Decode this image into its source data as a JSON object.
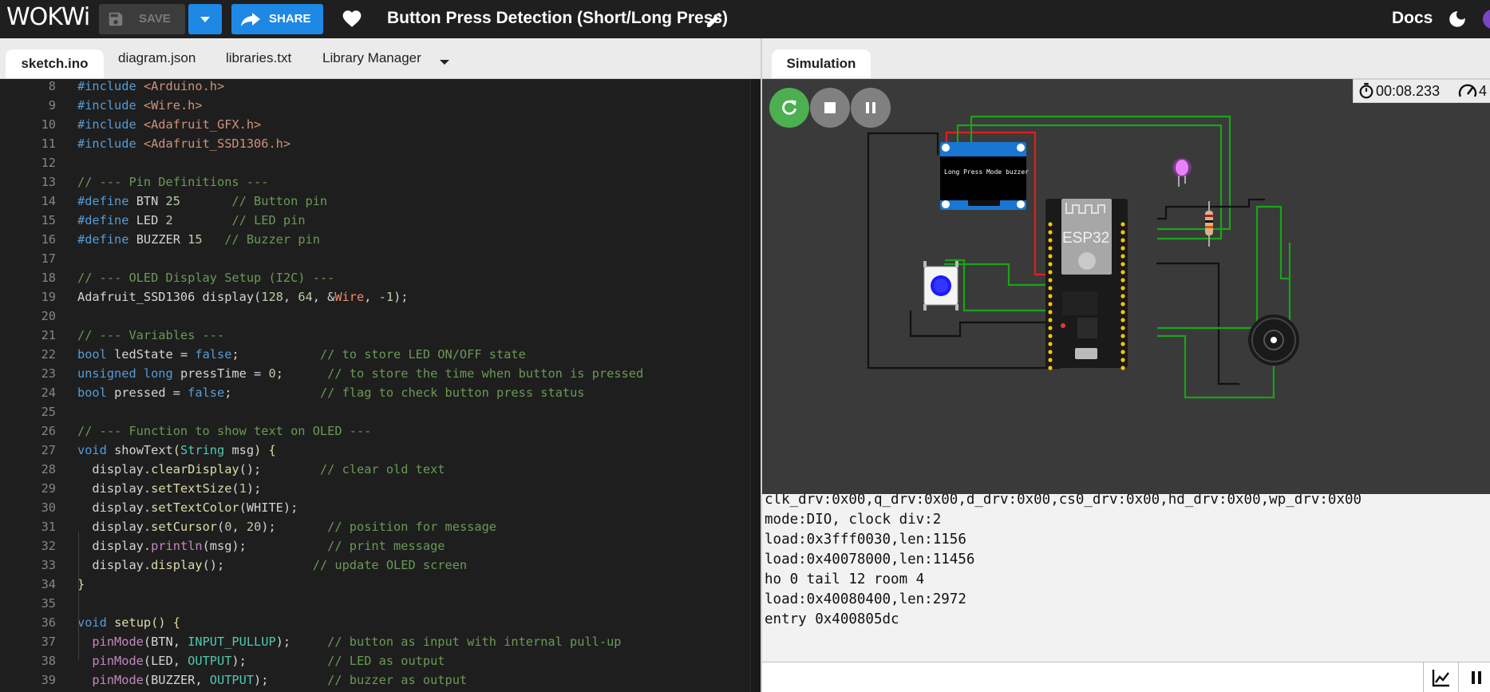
{
  "header": {
    "logo": "WOKWi",
    "save_label": "SAVE",
    "share_label": "SHARE",
    "project_title": "Button Press Detection (Short/Long Press)",
    "docs_label": "Docs"
  },
  "editor_tabs": [
    "sketch.ino",
    "diagram.json",
    "libraries.txt",
    "Library Manager"
  ],
  "simulation_tab": "Simulation",
  "timer": "00:08.233",
  "timer_trailing": "4",
  "oled_text": "Long Press Mode buzzer",
  "esp32_label": "ESP32",
  "code_lines": [
    {
      "n": "8",
      "t": [
        [
          "#include ",
          "t-p"
        ],
        [
          "<Arduino.h>",
          "t-h"
        ]
      ]
    },
    {
      "n": "9",
      "t": [
        [
          "#include ",
          "t-p"
        ],
        [
          "<Wire.h>",
          "t-h"
        ]
      ]
    },
    {
      "n": "10",
      "t": [
        [
          "#include ",
          "t-p"
        ],
        [
          "<Adafruit_GFX.h>",
          "t-h"
        ]
      ]
    },
    {
      "n": "11",
      "t": [
        [
          "#include ",
          "t-p"
        ],
        [
          "<Adafruit_SSD1306.h>",
          "t-h"
        ]
      ]
    },
    {
      "n": "12",
      "t": []
    },
    {
      "n": "13",
      "t": [
        [
          "// --- Pin Definitions ---",
          "t-c"
        ]
      ]
    },
    {
      "n": "14",
      "t": [
        [
          "#define ",
          "t-p"
        ],
        [
          "BTN ",
          ""
        ],
        [
          "25",
          "t-n"
        ],
        [
          "       ",
          ""
        ],
        [
          "// Button pin",
          "t-c"
        ]
      ]
    },
    {
      "n": "15",
      "t": [
        [
          "#define ",
          "t-p"
        ],
        [
          "LED ",
          ""
        ],
        [
          "2",
          "t-n"
        ],
        [
          "        ",
          ""
        ],
        [
          "// LED pin",
          "t-c"
        ]
      ]
    },
    {
      "n": "16",
      "t": [
        [
          "#define ",
          "t-p"
        ],
        [
          "BUZZER ",
          ""
        ],
        [
          "15",
          "t-n"
        ],
        [
          "   ",
          ""
        ],
        [
          "// Buzzer pin",
          "t-c"
        ]
      ]
    },
    {
      "n": "17",
      "t": []
    },
    {
      "n": "18",
      "t": [
        [
          "// --- OLED Display Setup (I2C) ---",
          "t-c"
        ]
      ]
    },
    {
      "n": "19",
      "t": [
        [
          "Adafruit_SSD1306 display(",
          ""
        ],
        [
          "128",
          "t-n"
        ],
        [
          ", ",
          ""
        ],
        [
          "64",
          "t-n"
        ],
        [
          ", &",
          ""
        ],
        [
          "Wire",
          "t-s"
        ],
        [
          ", ",
          ""
        ],
        [
          "-1",
          "t-n"
        ],
        [
          ");",
          ""
        ]
      ]
    },
    {
      "n": "20",
      "t": []
    },
    {
      "n": "21",
      "t": [
        [
          "// --- Variables ---",
          "t-c"
        ]
      ]
    },
    {
      "n": "22",
      "t": [
        [
          "bool ",
          "t-p"
        ],
        [
          "ledState = ",
          ""
        ],
        [
          "false",
          "t-p"
        ],
        [
          ";           ",
          ""
        ],
        [
          "// to store LED ON/OFF state",
          "t-c"
        ]
      ]
    },
    {
      "n": "23",
      "t": [
        [
          "unsigned ",
          "t-p"
        ],
        [
          "long ",
          "t-p"
        ],
        [
          "pressTime = ",
          ""
        ],
        [
          "0",
          "t-n"
        ],
        [
          ";      ",
          ""
        ],
        [
          "// to store the time when button is pressed",
          "t-c"
        ]
      ]
    },
    {
      "n": "24",
      "t": [
        [
          "bool ",
          "t-p"
        ],
        [
          "pressed = ",
          ""
        ],
        [
          "false",
          "t-p"
        ],
        [
          ";            ",
          ""
        ],
        [
          "// flag to check button press status",
          "t-c"
        ]
      ]
    },
    {
      "n": "25",
      "t": []
    },
    {
      "n": "26",
      "t": [
        [
          "// --- Function to show text on OLED ---",
          "t-c"
        ]
      ]
    },
    {
      "n": "27",
      "t": [
        [
          "void ",
          "t-p"
        ],
        [
          "showText",
          ""
        ],
        [
          "(",
          "t-f"
        ],
        [
          "String ",
          "t-ty"
        ],
        [
          "msg",
          ""
        ],
        [
          ") {",
          "t-f"
        ]
      ]
    },
    {
      "n": "28",
      "t": [
        [
          "  display.",
          ""
        ],
        [
          "clearDisplay",
          "t-f"
        ],
        [
          "();        ",
          ""
        ],
        [
          "// clear old text",
          "t-c"
        ]
      ]
    },
    {
      "n": "29",
      "t": [
        [
          "  display.",
          ""
        ],
        [
          "setTextSize",
          "t-f"
        ],
        [
          "(",
          ""
        ],
        [
          "1",
          "t-n"
        ],
        [
          ");",
          ""
        ]
      ]
    },
    {
      "n": "30",
      "t": [
        [
          "  display.",
          ""
        ],
        [
          "setTextColor",
          "t-f"
        ],
        [
          "(WHITE);",
          ""
        ]
      ]
    },
    {
      "n": "31",
      "t": [
        [
          "  display.",
          ""
        ],
        [
          "setCursor",
          "t-f"
        ],
        [
          "(",
          ""
        ],
        [
          "0",
          "t-n"
        ],
        [
          ", ",
          ""
        ],
        [
          "20",
          "t-n"
        ],
        [
          ");       ",
          ""
        ],
        [
          "// position for message",
          "t-c"
        ]
      ]
    },
    {
      "n": "32",
      "t": [
        [
          "  display.",
          ""
        ],
        [
          "println",
          "t-m"
        ],
        [
          "(msg);           ",
          ""
        ],
        [
          "// print message",
          "t-c"
        ]
      ]
    },
    {
      "n": "33",
      "t": [
        [
          "  display.",
          ""
        ],
        [
          "display",
          "t-f"
        ],
        [
          "();            ",
          ""
        ],
        [
          "// update OLED screen",
          "t-c"
        ]
      ]
    },
    {
      "n": "34",
      "t": [
        [
          "}",
          "t-f"
        ]
      ]
    },
    {
      "n": "35",
      "t": []
    },
    {
      "n": "36",
      "t": [
        [
          "void ",
          "t-p"
        ],
        [
          "setup",
          "t-f"
        ],
        [
          "() {",
          "t-f"
        ]
      ]
    },
    {
      "n": "37",
      "t": [
        [
          "  ",
          ""
        ],
        [
          "pinMode",
          "t-m"
        ],
        [
          "(BTN, ",
          ""
        ],
        [
          "INPUT_PULLUP",
          "t-ty"
        ],
        [
          ");     ",
          ""
        ],
        [
          "// button as input with internal pull-up",
          "t-c"
        ]
      ]
    },
    {
      "n": "38",
      "t": [
        [
          "  ",
          ""
        ],
        [
          "pinMode",
          "t-m"
        ],
        [
          "(LED, ",
          ""
        ],
        [
          "OUTPUT",
          "t-ty"
        ],
        [
          ");           ",
          ""
        ],
        [
          "// LED as output",
          "t-c"
        ]
      ]
    },
    {
      "n": "39",
      "t": [
        [
          "  ",
          ""
        ],
        [
          "pinMode",
          "t-m"
        ],
        [
          "(BUZZER, ",
          ""
        ],
        [
          "OUTPUT",
          "t-ty"
        ],
        [
          ");        ",
          ""
        ],
        [
          "// buzzer as output",
          "t-c"
        ]
      ]
    }
  ],
  "serial_lines": [
    "clk_drv:0x00,q_drv:0x00,d_drv:0x00,cs0_drv:0x00,hd_drv:0x00,wp_drv:0x00",
    "mode:DIO, clock div:2",
    "load:0x3fff0030,len:1156",
    "load:0x40078000,len:11456",
    "ho 0 tail 12 room 4",
    "load:0x40080400,len:2972",
    "entry 0x400805dc"
  ],
  "serial_input_value": "",
  "colors": {
    "accent": "#1e88e5",
    "restart": "#4caf50",
    "control": "#808080",
    "wire_green": "#1aa31a",
    "wire_red": "#e0201c",
    "wire_black": "#111111",
    "board": "#1a1a1a",
    "led": "#e040fb"
  },
  "icons": [
    "save-icon",
    "chevron-down-icon",
    "share-icon",
    "heart-icon",
    "pencil-icon",
    "moon-icon",
    "restart-icon",
    "stop-icon",
    "pause-icon",
    "stopwatch-icon",
    "speedometer-icon",
    "chart-icon"
  ]
}
